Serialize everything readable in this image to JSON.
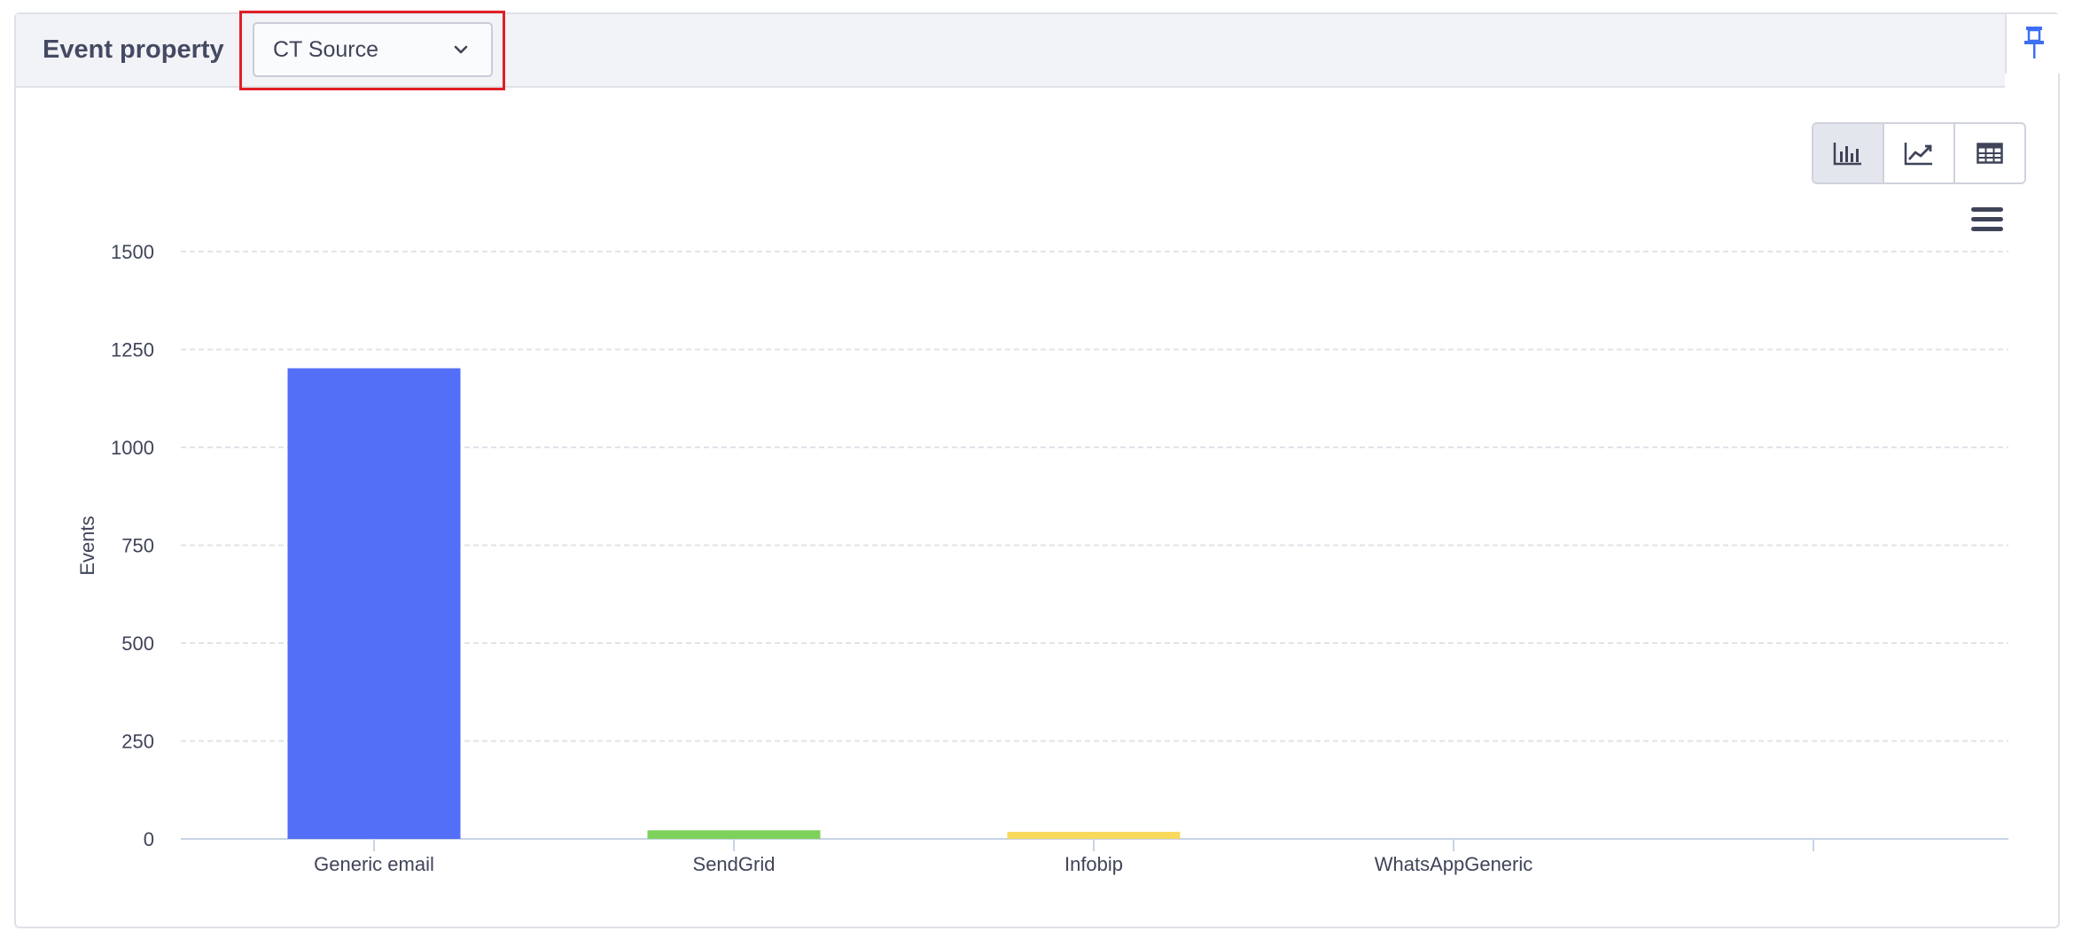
{
  "header": {
    "title": "Event property",
    "dropdown_value": "CT Source"
  },
  "icons": {
    "pin": "pin-icon",
    "dropdown": "chevron-down-icon",
    "bar_view": "bar-chart-icon",
    "line_view": "line-chart-icon",
    "table_view": "table-icon",
    "menu": "hamburger-menu-icon"
  },
  "colors": {
    "highlight": "#e01f26",
    "pin": "#3d6ef5"
  },
  "chart_data": {
    "type": "bar",
    "categories": [
      "Generic email",
      "SendGrid",
      "Infobip",
      "WhatsAppGeneric",
      ""
    ],
    "values": [
      1202,
      22,
      18,
      0,
      0
    ],
    "colors": [
      "#536ef7",
      "#7ed15b",
      "#f7d95c",
      "#8b8fa3",
      "#8b8fa3"
    ],
    "ylabel": "Events",
    "ylim": [
      0,
      1500
    ],
    "yticks": [
      0,
      250,
      500,
      750,
      1000,
      1250,
      1500
    ],
    "grid": true
  }
}
